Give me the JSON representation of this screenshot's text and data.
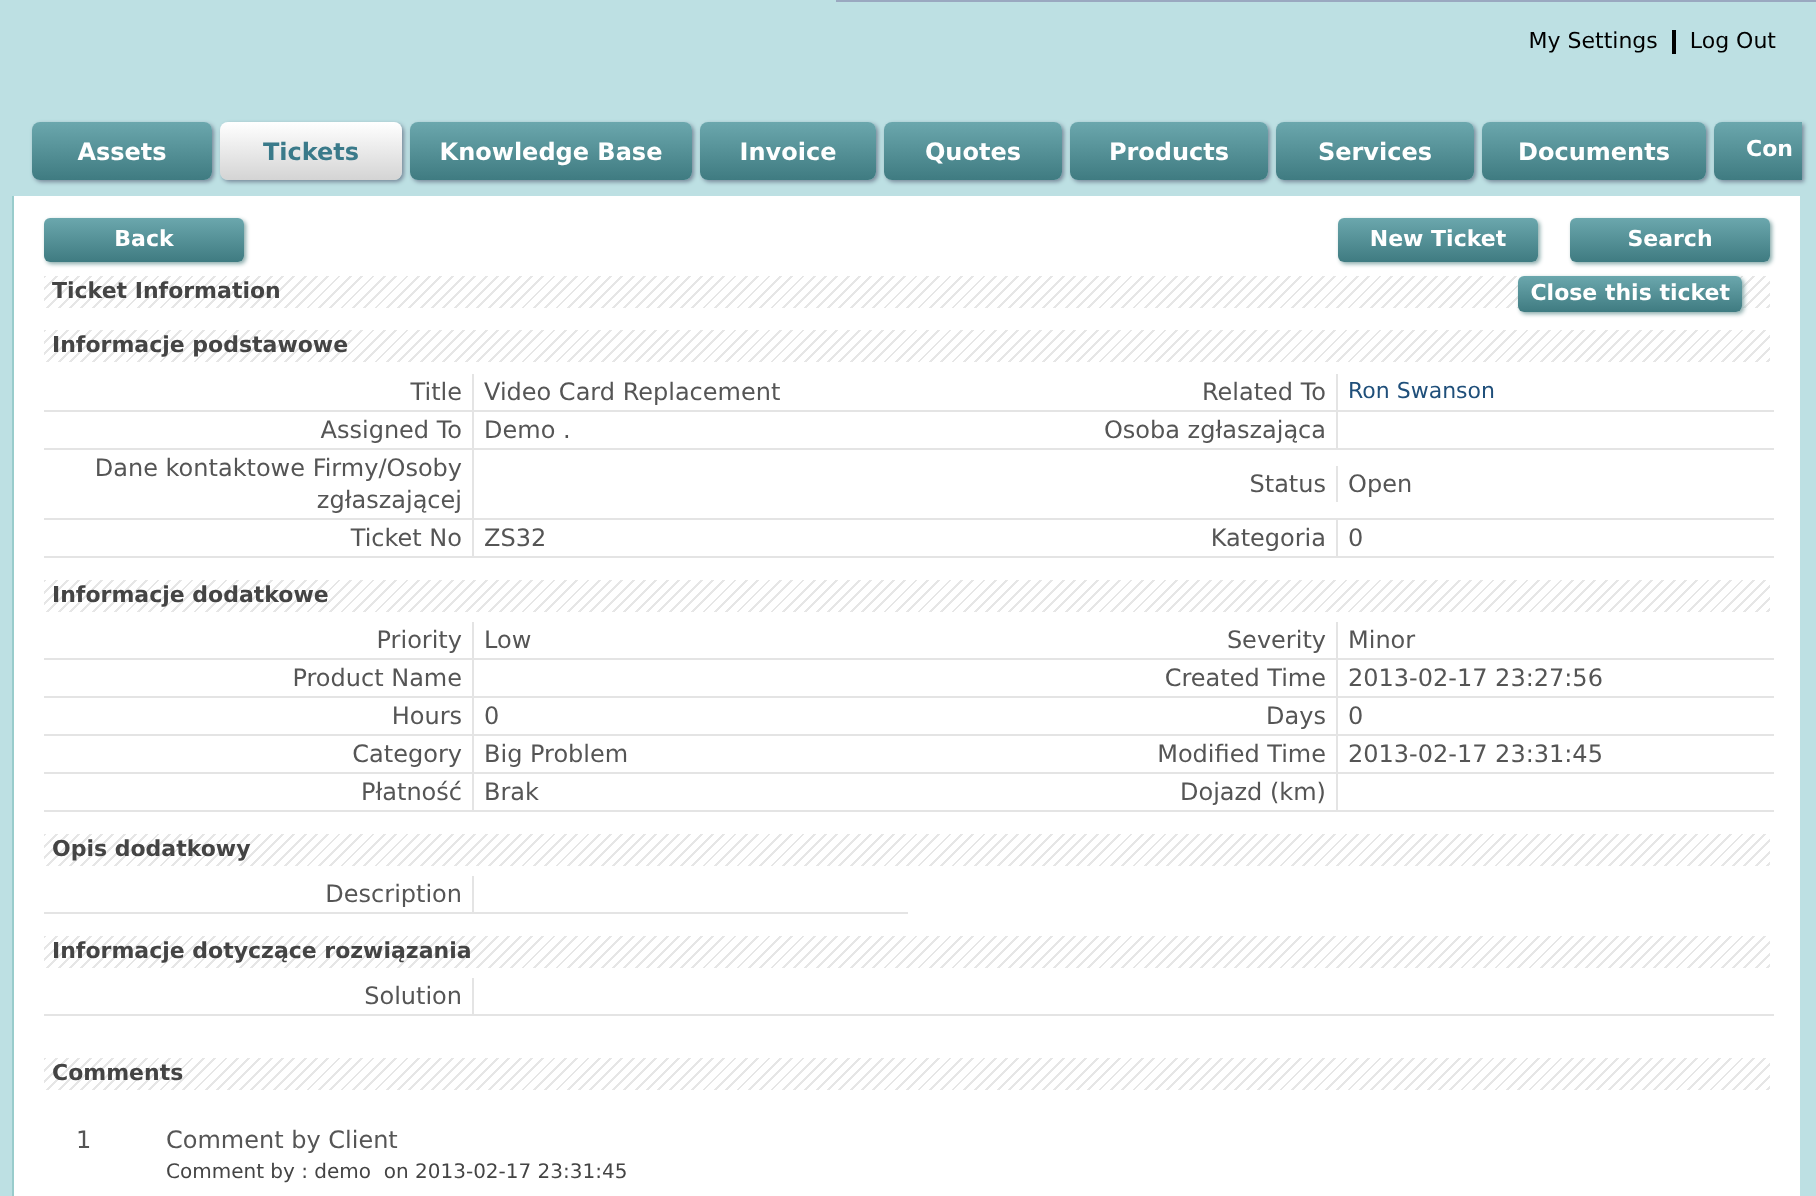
{
  "top_links": [
    "My Settings",
    "Log Out"
  ],
  "tabs": [
    {
      "label": "Assets",
      "selected": false
    },
    {
      "label": "Tickets",
      "selected": true
    },
    {
      "label": "Knowledge Base",
      "selected": false
    },
    {
      "label": "Invoice",
      "selected": false
    },
    {
      "label": "Quotes",
      "selected": false
    },
    {
      "label": "Products",
      "selected": false
    },
    {
      "label": "Services",
      "selected": false
    },
    {
      "label": "Documents",
      "selected": false
    },
    {
      "label": "Con",
      "selected": false
    }
  ],
  "buttons": {
    "back": "Back",
    "new_ticket": "New Ticket",
    "search": "Search",
    "close_ticket": "Close this ticket"
  },
  "header": "Ticket Information",
  "sections": [
    {
      "title": "Informacje podstawowe",
      "rows": [
        [
          {
            "label": "Title",
            "value": "Video Card Replacement",
            "kind": "text"
          },
          {
            "label": "Related To",
            "value": "Ron Swanson",
            "kind": "link"
          }
        ],
        [
          {
            "label": "Assigned To",
            "value": "Demo .",
            "kind": "text"
          },
          {
            "label": "Osoba zgłaszająca",
            "kind": "text"
          }
        ],
        [
          {
            "label": "Dane kontaktowe Firmy/Osoby zgłaszającej",
            "kind": "text"
          },
          {
            "label": "Status",
            "value": "Open",
            "kind": "text"
          }
        ],
        [
          {
            "label": "Ticket No",
            "value": "ZS32",
            "kind": "text"
          },
          {
            "label": "Kategoria",
            "value": "0",
            "kind": "text"
          }
        ]
      ]
    },
    {
      "title": "Informacje dodatkowe",
      "rows": [
        [
          {
            "label": "Priority",
            "value": "Low",
            "kind": "text"
          },
          {
            "label": "Severity",
            "value": "Minor",
            "kind": "text"
          }
        ],
        [
          {
            "label": "Product Name",
            "kind": "text"
          },
          {
            "label": "Created Time",
            "value": "2013-02-17 23:27:56",
            "kind": "text"
          }
        ],
        [
          {
            "label": "Hours",
            "value": "0",
            "kind": "text"
          },
          {
            "label": "Days",
            "value": "0",
            "kind": "text"
          }
        ],
        [
          {
            "label": "Category",
            "value": "Big Problem",
            "kind": "text"
          },
          {
            "label": "Modified Time",
            "value": "2013-02-17 23:31:45",
            "kind": "text"
          }
        ],
        [
          {
            "label": "Płatność",
            "value": "Brak",
            "kind": "text"
          },
          {
            "label": "Dojazd (km)",
            "kind": "text"
          }
        ]
      ]
    },
    {
      "title": "Opis dodatkowy",
      "rows": [
        [
          {
            "label": "Description",
            "kind": "text"
          }
        ]
      ]
    },
    {
      "title": "Informacje dotyczące rozwiązania",
      "rows": [
        [
          {
            "label": "Solution",
            "kind": "wide"
          }
        ]
      ]
    }
  ],
  "comments": {
    "title": "Comments",
    "items": [
      {
        "number": "1",
        "text": "Comment by Client",
        "meta": "Comment by : demo  on 2013-02-17 23:31:45"
      }
    ]
  }
}
